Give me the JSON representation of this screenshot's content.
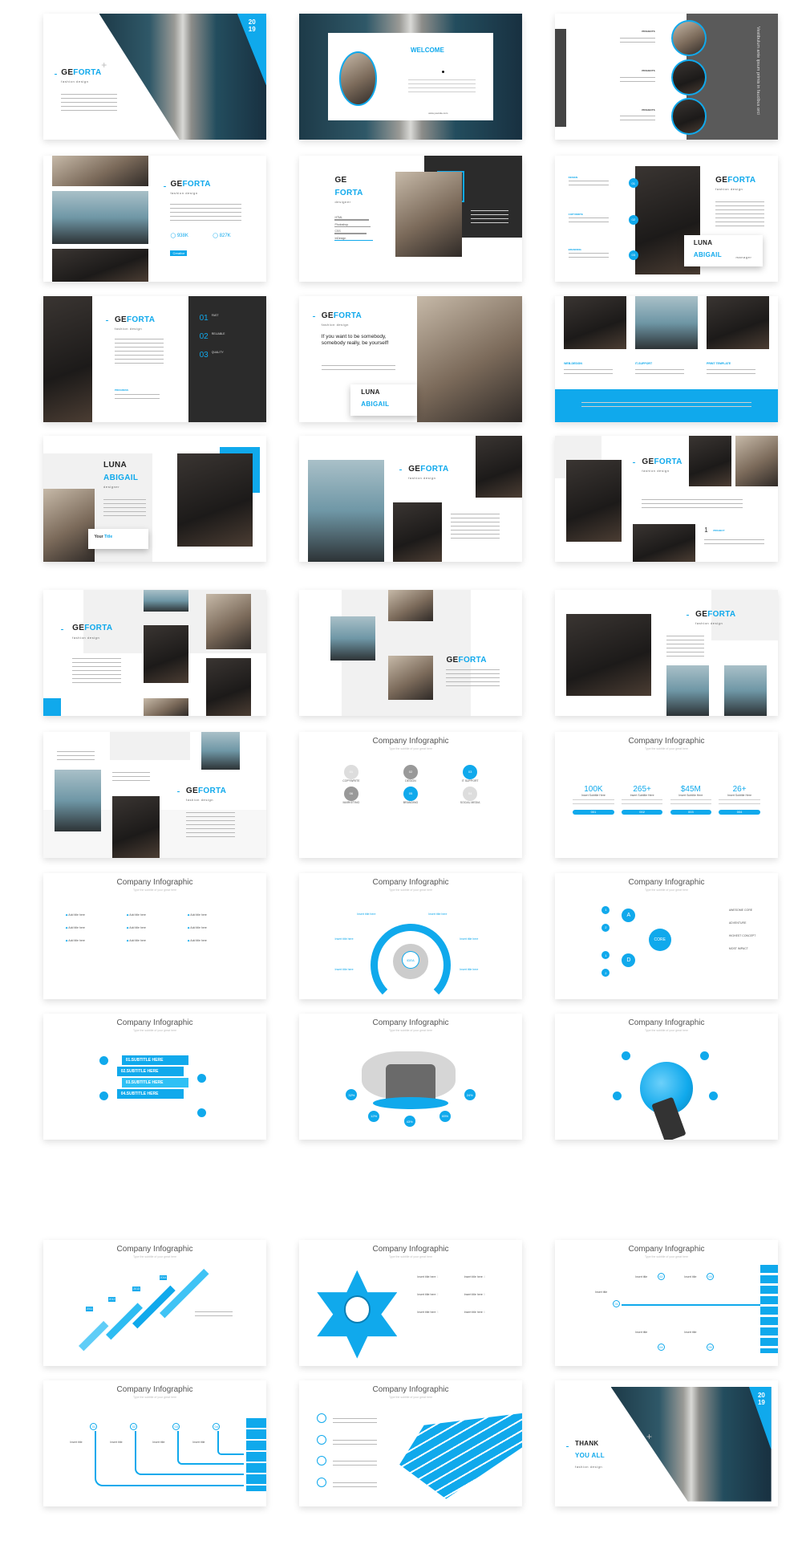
{
  "colors": {
    "accent": "#10a9ec",
    "dark": "#2b2b2b",
    "panel": "#5a5a5a"
  },
  "brand": {
    "ge": "GE",
    "forta": "FORTA",
    "tagline": "fashion design",
    "designer": "designer",
    "manager": "manager"
  },
  "s1": {
    "year_top": "20",
    "year_bottom": "19"
  },
  "s2": {
    "welcome": "WELCOME",
    "site": "www.yoursite.com"
  },
  "s3": {
    "vertical_text": "Vestibulum ante ipsum primis in faucibus orci",
    "projects": [
      "PROJECTS",
      "PROJECTS",
      "PROJECTS"
    ]
  },
  "s4": {
    "stat1": "938K",
    "stat2": "827K",
    "button": "Creative"
  },
  "s5": {
    "skills": [
      "HTML",
      "Photoshop",
      "CSS",
      "InDesign"
    ]
  },
  "s6": {
    "items": [
      "DESIGN",
      "COPYWRITE",
      "BRANDING"
    ],
    "nums": [
      "01",
      "02",
      "03"
    ],
    "first": "LUNA",
    "last": "ABIGAIL"
  },
  "s7": {
    "progress": "PROGRESS",
    "items": [
      {
        "n": "01",
        "label": "FAST"
      },
      {
        "n": "02",
        "label": "RELIABLE"
      },
      {
        "n": "03",
        "label": "QUALITY"
      }
    ]
  },
  "s8": {
    "quote": "If you want to be somebody, somebody really, be yourself!",
    "first": "LUNA",
    "last": "ABIGAIL"
  },
  "s9": {
    "items": [
      "WEB-DESIGN",
      "IT-SUPPORT",
      "PRINT TEMPLATE"
    ]
  },
  "s10": {
    "first": "LUNA",
    "last": "ABIGAIL",
    "card_a": "Your ",
    "card_b": "Title"
  },
  "s12": {
    "num": "1",
    "label": "PROJECT"
  },
  "infographic": {
    "title": "Company Infographic",
    "subtitle": "Type the subtitle of your great here"
  },
  "s17": {
    "items": [
      {
        "n": "01",
        "label": "COPYWRITE"
      },
      {
        "n": "02",
        "label": "DESIGN"
      },
      {
        "n": "03",
        "label": "IT SUPPORT"
      },
      {
        "n": "06",
        "label": "MARKETING"
      },
      {
        "n": "05",
        "label": "BRANDING"
      },
      {
        "n": "04",
        "label": "SOCIAL MEDIA"
      }
    ]
  },
  "s18": {
    "stats": [
      {
        "v": "100K",
        "s": "Insert Subtitle Here",
        "b": "001"
      },
      {
        "v": "265+",
        "s": "Insert Subtitle Here",
        "b": "002"
      },
      {
        "v": "$45M",
        "s": "Insert Subtitle Here",
        "b": "003"
      },
      {
        "v": "26+",
        "s": "Insert Subtitle Here",
        "b": "004"
      }
    ]
  },
  "s19": {
    "item": "Add title here"
  },
  "s20": {
    "item": "Insert title here",
    "center": "IDEA"
  },
  "s21": {
    "core": "CORE",
    "a": "A",
    "d": "D",
    "nums": [
      "1",
      "2",
      "1",
      "2"
    ],
    "right": [
      "AWESOME CORE",
      "ADVENTURE",
      "HIGHEST CONCEPT",
      "MOST IMPACT"
    ]
  },
  "s22": {
    "items": [
      "01.SUBTITLE HERE",
      "02.SUBTITLE HERE",
      "03.SUBTITLE HERE",
      "04.SUBTITLE HERE"
    ]
  },
  "s23": {
    "pcts": [
      "32%",
      "24%",
      "12%",
      "43%",
      "65%"
    ]
  },
  "s25": {
    "years": [
      "2011",
      "2012",
      "2013",
      "2014"
    ]
  },
  "s26": {
    "item": "Insert title here",
    "nums": [
      "1",
      "2",
      "3",
      "4",
      "5",
      "6"
    ]
  },
  "s27": {
    "item": "Insert title",
    "nums": [
      "01",
      "02",
      "03",
      "04",
      "05"
    ]
  },
  "s28": {
    "item": "Insert title",
    "nums": [
      "01",
      "02",
      "03",
      "04"
    ]
  },
  "s30": {
    "thank": "THANK",
    "you": "YOU ALL",
    "year_top": "20",
    "year_bottom": "19"
  }
}
